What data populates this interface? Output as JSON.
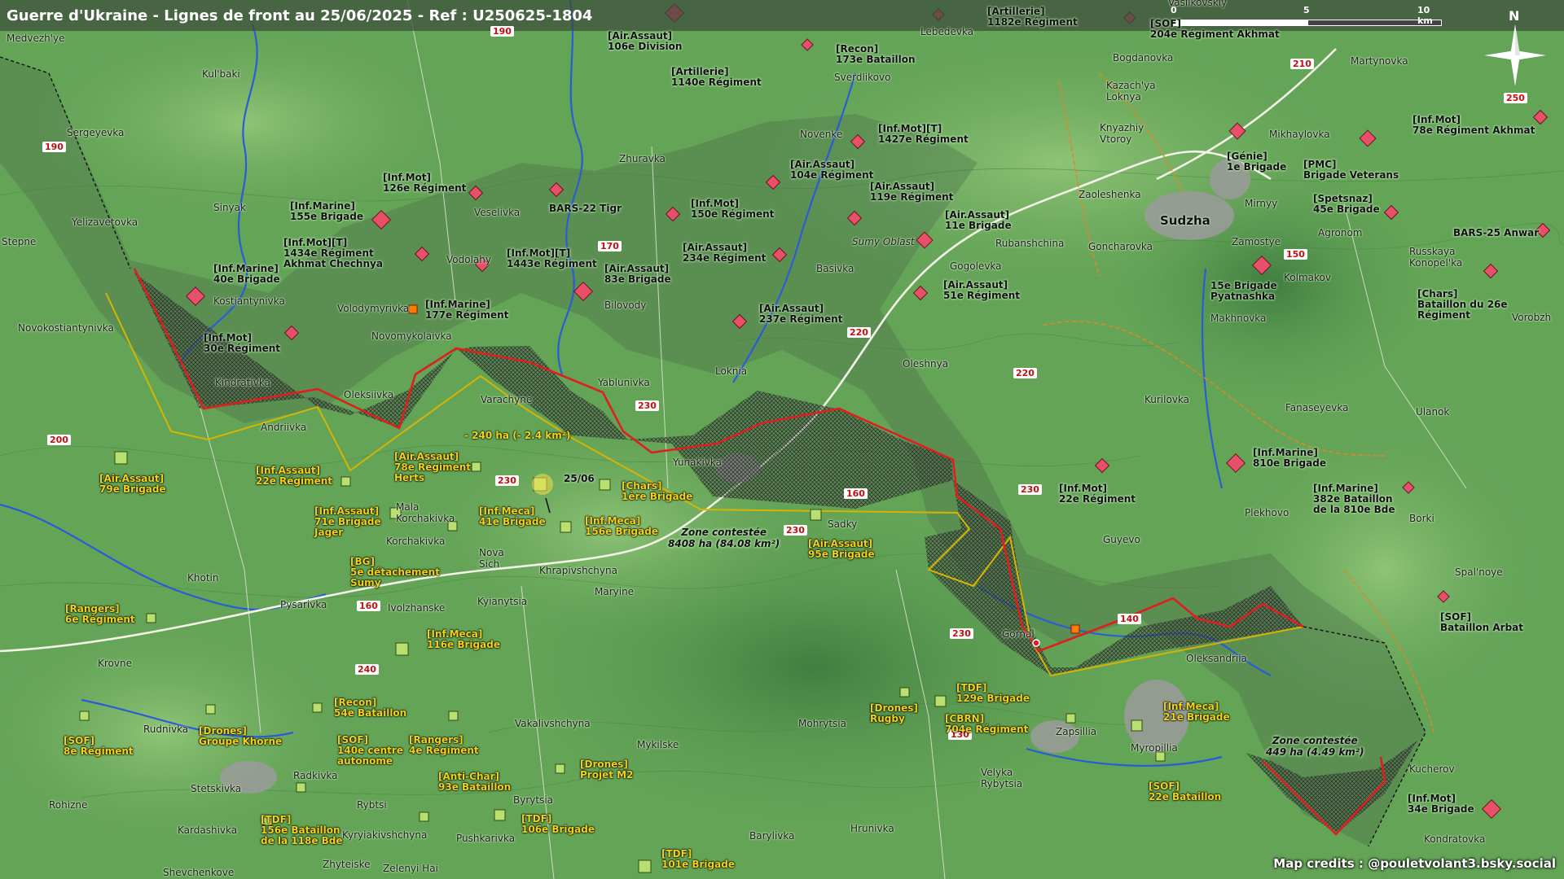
{
  "title": "Guerre d'Ukraine - Lignes de front au 25/06/2025 - Ref : U250625-1804",
  "credits": "Map credits : @pouletvolant3.bsky.social",
  "compass_label": "N",
  "scale": {
    "labels": [
      "0",
      "5",
      "10 km"
    ]
  },
  "colors": {
    "front_line": "#e01e1e",
    "ua_line": "#d8b400",
    "ru_marker": "#e8506a",
    "ua_marker": "#b8e070",
    "river": "#2a5cd8"
  },
  "places": [
    {
      "id": "medvezhye",
      "text": "Medvezh'ye"
    },
    {
      "id": "kulbaki",
      "text": "Kul'baki"
    },
    {
      "id": "sergeyevka",
      "text": "Sergeyevka"
    },
    {
      "id": "sinyak",
      "text": "Sinyak"
    },
    {
      "id": "yelizavetovka",
      "text": "Yelizavetovka"
    },
    {
      "id": "stepne",
      "text": "Stepne"
    },
    {
      "id": "kostiantynivka",
      "text": "Kostiantynivka"
    },
    {
      "id": "novokostiantynivka",
      "text": "Novokostiantynivka"
    },
    {
      "id": "kindrativka",
      "text": "Kindrativka"
    },
    {
      "id": "andriivka",
      "text": "Andriivka"
    },
    {
      "id": "oleksiivka",
      "text": "Oleksiivka"
    },
    {
      "id": "varachyne",
      "text": "Varachyne"
    },
    {
      "id": "yablunivka",
      "text": "Yablunivka"
    },
    {
      "id": "volodymyrivka",
      "text": "Volodymyrivka"
    },
    {
      "id": "novomykolaivka",
      "text": "Novomykolaivka"
    },
    {
      "id": "vodolahy",
      "text": "Vodolahy"
    },
    {
      "id": "veselivka",
      "text": "Veselivka"
    },
    {
      "id": "bilovody",
      "text": "Bilovody"
    },
    {
      "id": "zhuravka",
      "text": "Zhuravka"
    },
    {
      "id": "novenke",
      "text": "Novenke"
    },
    {
      "id": "sverdlikovo",
      "text": "Sverdlikovo"
    },
    {
      "id": "lebedevka",
      "text": "Lebedevka"
    },
    {
      "id": "basivka",
      "text": "Basivka"
    },
    {
      "id": "loknia",
      "text": "Loknia"
    },
    {
      "id": "yunakivka",
      "text": "Yunakivka"
    },
    {
      "id": "sadky",
      "text": "Sadky"
    },
    {
      "id": "mala_korchakivka",
      "text": "Mala\nKorchakivka"
    },
    {
      "id": "korchakivka",
      "text": "Korchakivka"
    },
    {
      "id": "nova_sich",
      "text": "Nova\nSich"
    },
    {
      "id": "khrapivshchyna",
      "text": "Khrapivshchyna"
    },
    {
      "id": "kyianytsia",
      "text": "Kyianytsia"
    },
    {
      "id": "ivolzhanske",
      "text": "Ivolzhanske"
    },
    {
      "id": "pysarivka",
      "text": "Pysarivka"
    },
    {
      "id": "khotin",
      "text": "Khotin"
    },
    {
      "id": "maryine",
      "text": "Maryine"
    },
    {
      "id": "krovne",
      "text": "Krovne"
    },
    {
      "id": "rudnivka",
      "text": "Rudnivka"
    },
    {
      "id": "stetskivka",
      "text": "Stetskivka"
    },
    {
      "id": "radkivka",
      "text": "Radkivka"
    },
    {
      "id": "rohizne",
      "text": "Rohizne"
    },
    {
      "id": "kardashivka",
      "text": "Kardashivka"
    },
    {
      "id": "rybtsi",
      "text": "Rybtsi"
    },
    {
      "id": "kyryiakivshchyna",
      "text": "Kyryiakivshchyna"
    },
    {
      "id": "pushkarivka",
      "text": "Pushkarivka"
    },
    {
      "id": "shevchenkove",
      "text": "Shevchenkove"
    },
    {
      "id": "zhyteiske",
      "text": "Zhyteiske"
    },
    {
      "id": "zelenyi_hai",
      "text": "Zelenyi Hai"
    },
    {
      "id": "vakalivshchyna",
      "text": "Vakalivshchyna"
    },
    {
      "id": "mykilske",
      "text": "Mykilske"
    },
    {
      "id": "byrytsia",
      "text": "Byrytsia"
    },
    {
      "id": "mohrytsia",
      "text": "Mohrytsia"
    },
    {
      "id": "velyka_rybytsia",
      "text": "Velyka\nRybytsia"
    },
    {
      "id": "barylivka",
      "text": "Barylivka"
    },
    {
      "id": "hrunivka",
      "text": "Hrunivka"
    },
    {
      "id": "zapsillia",
      "text": "Zapsillia"
    },
    {
      "id": "myropillia",
      "text": "Myropillia"
    },
    {
      "id": "kucherov",
      "text": "Kucherov"
    },
    {
      "id": "kondratovka",
      "text": "Kondratovka"
    },
    {
      "id": "gornal",
      "text": "Gornal"
    },
    {
      "id": "oleksandriia",
      "text": "Oleksandriia"
    },
    {
      "id": "guyevo",
      "text": "Guyevo"
    },
    {
      "id": "plekhovo",
      "text": "Plekhovo"
    },
    {
      "id": "borki",
      "text": "Borki"
    },
    {
      "id": "spalnoye",
      "text": "Spal'noye"
    },
    {
      "id": "ulanok",
      "text": "Ulanok"
    },
    {
      "id": "fanaseyevka",
      "text": "Fanaseyevka"
    },
    {
      "id": "kurilovka",
      "text": "Kurilovka"
    },
    {
      "id": "makhnovka",
      "text": "Makhnovka"
    },
    {
      "id": "kolmakov",
      "text": "Kolmakov"
    },
    {
      "id": "russkaya_konopelka",
      "text": "Russkaya\nKonopel'ka"
    },
    {
      "id": "vorobzh",
      "text": "Vorobzh"
    },
    {
      "id": "agronom",
      "text": "Agronom"
    },
    {
      "id": "zamostye",
      "text": "Zamostye"
    },
    {
      "id": "mirnyy",
      "text": "Mirnyy"
    },
    {
      "id": "sudzha",
      "text": "Sudzha"
    },
    {
      "id": "goncharovka",
      "text": "Goncharovka"
    },
    {
      "id": "zaoleshenka",
      "text": "Zaoleshenka"
    },
    {
      "id": "rubanshchina",
      "text": "Rubanshchina"
    },
    {
      "id": "gogolevka",
      "text": "Gogolevka"
    },
    {
      "id": "oleshnya",
      "text": "Oleshnya"
    },
    {
      "id": "sumy_oblast",
      "text": "Sumy Oblast"
    },
    {
      "id": "kazachya_loknya",
      "text": "Kazach'ya\nLoknya"
    },
    {
      "id": "knyazhiy_vtoroy",
      "text": "Knyazhiy\nVtoroy"
    },
    {
      "id": "bogdanovka",
      "text": "Bogdanovka"
    },
    {
      "id": "martynovka",
      "text": "Martynovka"
    },
    {
      "id": "mikhaylovka",
      "text": "Mikhaylovka"
    },
    {
      "id": "vasilkovskiy",
      "text": "Vasilkovskiy"
    }
  ],
  "roads": [
    {
      "id": "r190a",
      "text": "190"
    },
    {
      "id": "r190b",
      "text": "190"
    },
    {
      "id": "r170",
      "text": "170"
    },
    {
      "id": "r210",
      "text": "210"
    },
    {
      "id": "r250",
      "text": "250"
    },
    {
      "id": "r150",
      "text": "150"
    },
    {
      "id": "r220a",
      "text": "220"
    },
    {
      "id": "r220b",
      "text": "220"
    },
    {
      "id": "r230a",
      "text": "230"
    },
    {
      "id": "r230b",
      "text": "230"
    },
    {
      "id": "r230c",
      "text": "230"
    },
    {
      "id": "r230d",
      "text": "230"
    },
    {
      "id": "r230e",
      "text": "230"
    },
    {
      "id": "r160a",
      "text": "160"
    },
    {
      "id": "r160b",
      "text": "160"
    },
    {
      "id": "r200",
      "text": "200"
    },
    {
      "id": "r240",
      "text": "240"
    },
    {
      "id": "r140",
      "text": "140"
    },
    {
      "id": "r130",
      "text": "130"
    }
  ],
  "units_ru": [
    {
      "id": "ru1",
      "text": "[Artillerie]\n1182e Régiment"
    },
    {
      "id": "ru2",
      "text": "[SOF]\n204e Régiment Akhmat"
    },
    {
      "id": "ru3",
      "text": "[Air.Assaut]\n106e Division"
    },
    {
      "id": "ru4",
      "text": "[Recon]\n173e Bataillon"
    },
    {
      "id": "ru5",
      "text": "[Artillerie]\n1140e Régiment"
    },
    {
      "id": "ru6",
      "text": "[Inf.Mot][T]\n1427e Régiment"
    },
    {
      "id": "ru7",
      "text": "[Air.Assaut]\n104e Régiment"
    },
    {
      "id": "ru8",
      "text": "[Air.Assaut]\n119e Régiment"
    },
    {
      "id": "ru9",
      "text": "[Inf.Mot]\n126e Régiment"
    },
    {
      "id": "ru10",
      "text": "BARS-22 Tigr"
    },
    {
      "id": "ru11",
      "text": "[Inf.Mot]\n150e Régiment"
    },
    {
      "id": "ru12",
      "text": "[Inf.Marine]\n155e Brigade"
    },
    {
      "id": "ru13",
      "text": "[Inf.Mot][T]\n1434e Régiment\nAkhmat Chechnya"
    },
    {
      "id": "ru14",
      "text": "[Inf.Mot][T]\n1443e Régiment"
    },
    {
      "id": "ru15",
      "text": "[Air.Assaut]\n234e Régiment"
    },
    {
      "id": "ru16",
      "text": "[Air.Assaut]\n11e Brigade"
    },
    {
      "id": "ru17",
      "text": "[Inf.Marine]\n40e Brigade"
    },
    {
      "id": "ru18",
      "text": "[Air.Assaut]\n83e Brigade"
    },
    {
      "id": "ru19",
      "text": "[Inf.Marine]\n177e Régiment"
    },
    {
      "id": "ru20",
      "text": "[Air.Assaut]\n237e Régiment"
    },
    {
      "id": "ru21",
      "text": "[Air.Assaut]\n51e Régiment"
    },
    {
      "id": "ru22",
      "text": "[Inf.Mot]\n30e Régiment"
    },
    {
      "id": "ru23",
      "text": "[Génie]\n1e Brigade"
    },
    {
      "id": "ru24",
      "text": "[PMC]\nBrigade Veterans"
    },
    {
      "id": "ru25",
      "text": "[Inf.Mot]\n78e Régiment Akhmat"
    },
    {
      "id": "ru26",
      "text": "[Spetsnaz]\n45e Brigade"
    },
    {
      "id": "ru27",
      "text": "BARS-25 Anwar"
    },
    {
      "id": "ru28",
      "text": "15e Brigade\nPyatnashka"
    },
    {
      "id": "ru29",
      "text": "[Chars]\nBataillon du 26e\nRégiment"
    },
    {
      "id": "ru30",
      "text": "[Inf.Marine]\n810e Brigade"
    },
    {
      "id": "ru31",
      "text": "[Inf.Mot]\n22e Régiment"
    },
    {
      "id": "ru32",
      "text": "[Inf.Marine]\n382e Bataillon\nde la 810e Bde"
    },
    {
      "id": "ru33",
      "text": "[SOF]\nBataillon Arbat"
    },
    {
      "id": "ru34",
      "text": "[Inf.Mot]\n34e Brigade"
    }
  ],
  "units_ua": [
    {
      "id": "ua1",
      "text": "[Air.Assaut]\n79e Brigade"
    },
    {
      "id": "ua2",
      "text": "[Inf.Assaut]\n22e Régiment"
    },
    {
      "id": "ua3",
      "text": "[Air.Assaut]\n78e Régiment\nHerts"
    },
    {
      "id": "ua4",
      "text": "[Chars]\n1ère Brigade"
    },
    {
      "id": "ua5",
      "text": "[Inf.Assaut]\n71e Brigade\nJager"
    },
    {
      "id": "ua6",
      "text": "[Inf.Meca]\n41e Brigade"
    },
    {
      "id": "ua7",
      "text": "[Inf.Meca]\n156e Brigade"
    },
    {
      "id": "ua8",
      "text": "[Air.Assaut]\n95e Brigade"
    },
    {
      "id": "ua9",
      "text": "[BG]\n5e détachement\nSumy"
    },
    {
      "id": "ua10",
      "text": "[Rangers]\n6e Régiment"
    },
    {
      "id": "ua11",
      "text": "[Inf.Meca]\n116e Brigade"
    },
    {
      "id": "ua12",
      "text": "[Recon]\n54e Bataillon"
    },
    {
      "id": "ua13",
      "text": "[Drones]\nGroupe Khorne"
    },
    {
      "id": "ua14",
      "text": "[SOF]\n8e Régiment"
    },
    {
      "id": "ua15",
      "text": "[SOF]\n140e centre\nautonome"
    },
    {
      "id": "ua16",
      "text": "[Rangers]\n4e Régiment"
    },
    {
      "id": "ua17",
      "text": "[Anti-Char]\n93e Bataillon"
    },
    {
      "id": "ua18",
      "text": "[Drones]\nProjet M2"
    },
    {
      "id": "ua19",
      "text": "[TDF]\n156e Bataillon\nde la 118e Bde"
    },
    {
      "id": "ua20",
      "text": "[TDF]\n106e Brigade"
    },
    {
      "id": "ua21",
      "text": "[TDF]\n101e Brigade"
    },
    {
      "id": "ua22",
      "text": "[Drones]\nRugby"
    },
    {
      "id": "ua23",
      "text": "[TDF]\n129e Brigade"
    },
    {
      "id": "ua24",
      "text": "[CBRN]\n704e Régiment"
    },
    {
      "id": "ua25",
      "text": "[Inf.Meca]\n21e Brigade"
    },
    {
      "id": "ua26",
      "text": "[SOF]\n22e Bataillon"
    }
  ],
  "annotations": [
    {
      "id": "loss240",
      "text": "- 240 ha (- 2.4 km²)"
    },
    {
      "id": "zone1",
      "text": "Zone contestée\n8408 ha (84.08 km²)"
    },
    {
      "id": "zone2",
      "text": "Zone contestée\n449 ha (4.49 km²)"
    },
    {
      "id": "date",
      "text": "25/06"
    }
  ]
}
